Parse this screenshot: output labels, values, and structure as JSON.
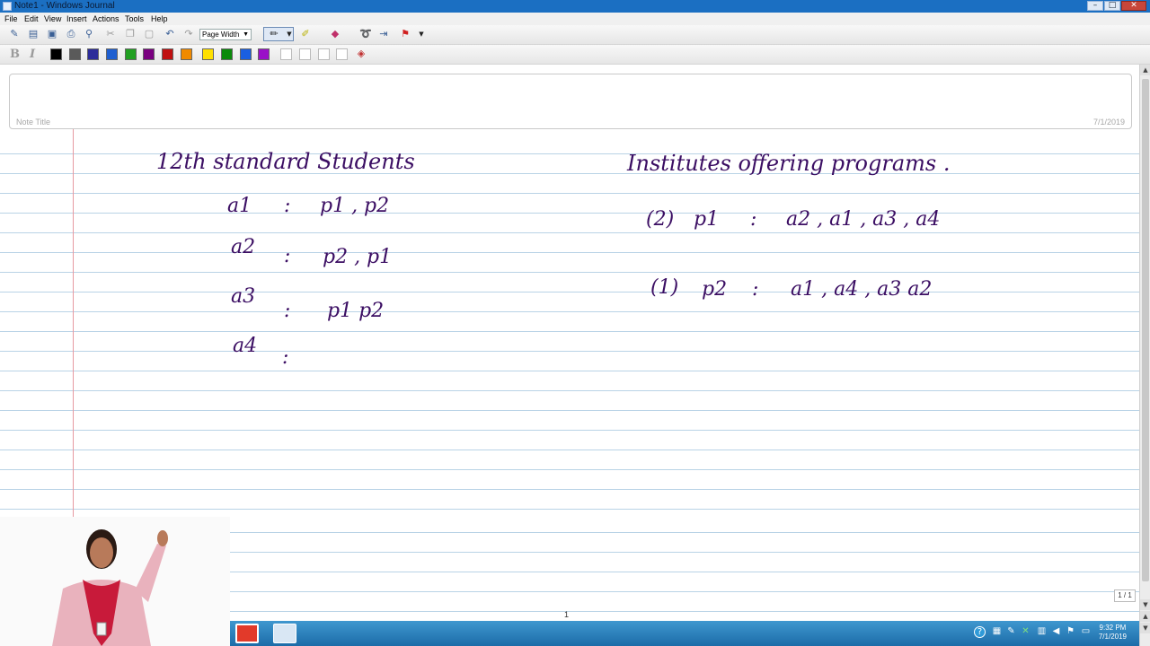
{
  "window": {
    "title": "Note1 - Windows Journal",
    "minimize": "–",
    "maximize": "□",
    "close": "✕"
  },
  "menu": [
    "File",
    "Edit",
    "View",
    "Insert",
    "Actions",
    "Tools",
    "Help"
  ],
  "toolbar": {
    "zoom_value": "Page Width",
    "icons": [
      "new-note-icon",
      "new-page-icon",
      "save-icon",
      "print-icon",
      "find-icon",
      "cut-icon",
      "copy-icon",
      "paste-icon",
      "undo-icon",
      "redo-icon"
    ],
    "tool_icons": [
      "pen-icon",
      "highlighter-icon",
      "eraser-icon",
      "lasso-icon",
      "insert-space-icon",
      "flag-icon"
    ],
    "bold_label": "B",
    "italic_label": "I",
    "pen_colors": [
      "#000000",
      "#5a5a5a",
      "#2c2c9a",
      "#1f5fd0",
      "#22a022",
      "#7a0080",
      "#c01010",
      "#f08a00",
      "#ffe000",
      "#0a8a0a",
      "#1a5fe0",
      "#9a10c8"
    ]
  },
  "note": {
    "title_placeholder": "Note Title",
    "date": "7/1/2019",
    "left_heading": "12th standard Students",
    "left_rows": [
      {
        "label": "a1",
        "colon": ":",
        "values": "p1 , p2"
      },
      {
        "label": "a2",
        "colon": ":",
        "values": "p2 , p1"
      },
      {
        "label": "a3",
        "colon": ":",
        "values": "p1  p2"
      },
      {
        "label": "a4",
        "colon": ":",
        "values": ""
      }
    ],
    "right_heading": "Institutes offering programs .",
    "right_rows": [
      {
        "rank": "(2)",
        "program": "p1",
        "colon": ":",
        "values": "a2 , a1 , a3 , a4"
      },
      {
        "rank": "(1)",
        "program": "p2",
        "colon": ":",
        "values": "a1 , a4 , a3  a2"
      }
    ]
  },
  "page_number": "1",
  "page_counter": "1 / 1",
  "taskbar": {
    "time": "9:32 PM",
    "date": "7/1/2019"
  },
  "colors": {
    "ink": "#3b0e63",
    "titlebar": "#1b6fc2",
    "taskbar": "#2a82bd",
    "rule": "#b9d3e6",
    "margin": "#e79aa1"
  }
}
